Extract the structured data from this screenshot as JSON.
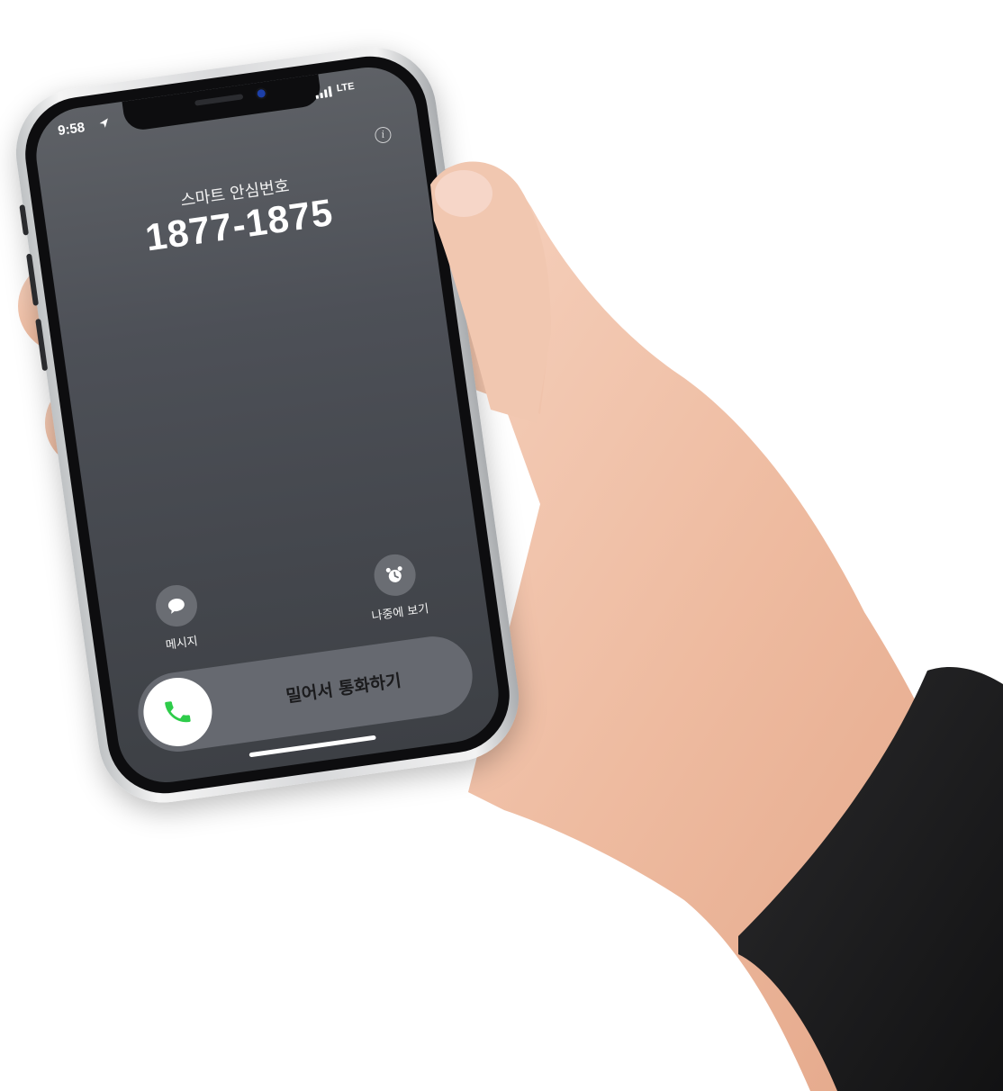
{
  "status_bar": {
    "time": "9:58",
    "network": "LTE",
    "location_icon": "location-arrow-icon",
    "signal_icon": "cellular-signal-icon"
  },
  "call": {
    "caller_label": "스마트 안심번호",
    "caller_number": "1877-1875",
    "info_icon": "info-icon"
  },
  "actions": {
    "message": {
      "label": "메시지",
      "icon": "message-bubble-icon"
    },
    "remind_later": {
      "label": "나중에 보기",
      "icon": "alarm-clock-icon"
    }
  },
  "slider": {
    "label": "밀어서 통화하기",
    "icon": "phone-icon",
    "accent": "#2ecc4a"
  },
  "colors": {
    "screen_top": "#5e6166",
    "screen_bottom": "#3d4045",
    "text": "#ffffff"
  }
}
